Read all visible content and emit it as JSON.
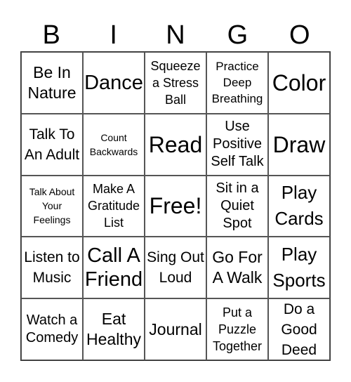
{
  "header": [
    "B",
    "I",
    "N",
    "G",
    "O"
  ],
  "cells": [
    "Be In Nature",
    "Dance",
    "Squeeze a Stress Ball",
    "Practice Deep Breathing",
    "Color",
    "Talk To An Adult",
    "Count Backwards",
    "Read",
    "Use Positive Self Talk",
    "Draw",
    "Talk About Your Feelings",
    "Make A Gratitude List",
    "Free!",
    "Sit in a Quiet Spot",
    "Play Cards",
    "Listen to Music",
    "Call A Friend",
    "Sing Out Loud",
    "Go For A Walk",
    "Play Sports",
    "Watch a Comedy",
    "Eat Healthy",
    "Journal",
    "Put a Puzzle Together",
    "Do a Good Deed"
  ]
}
